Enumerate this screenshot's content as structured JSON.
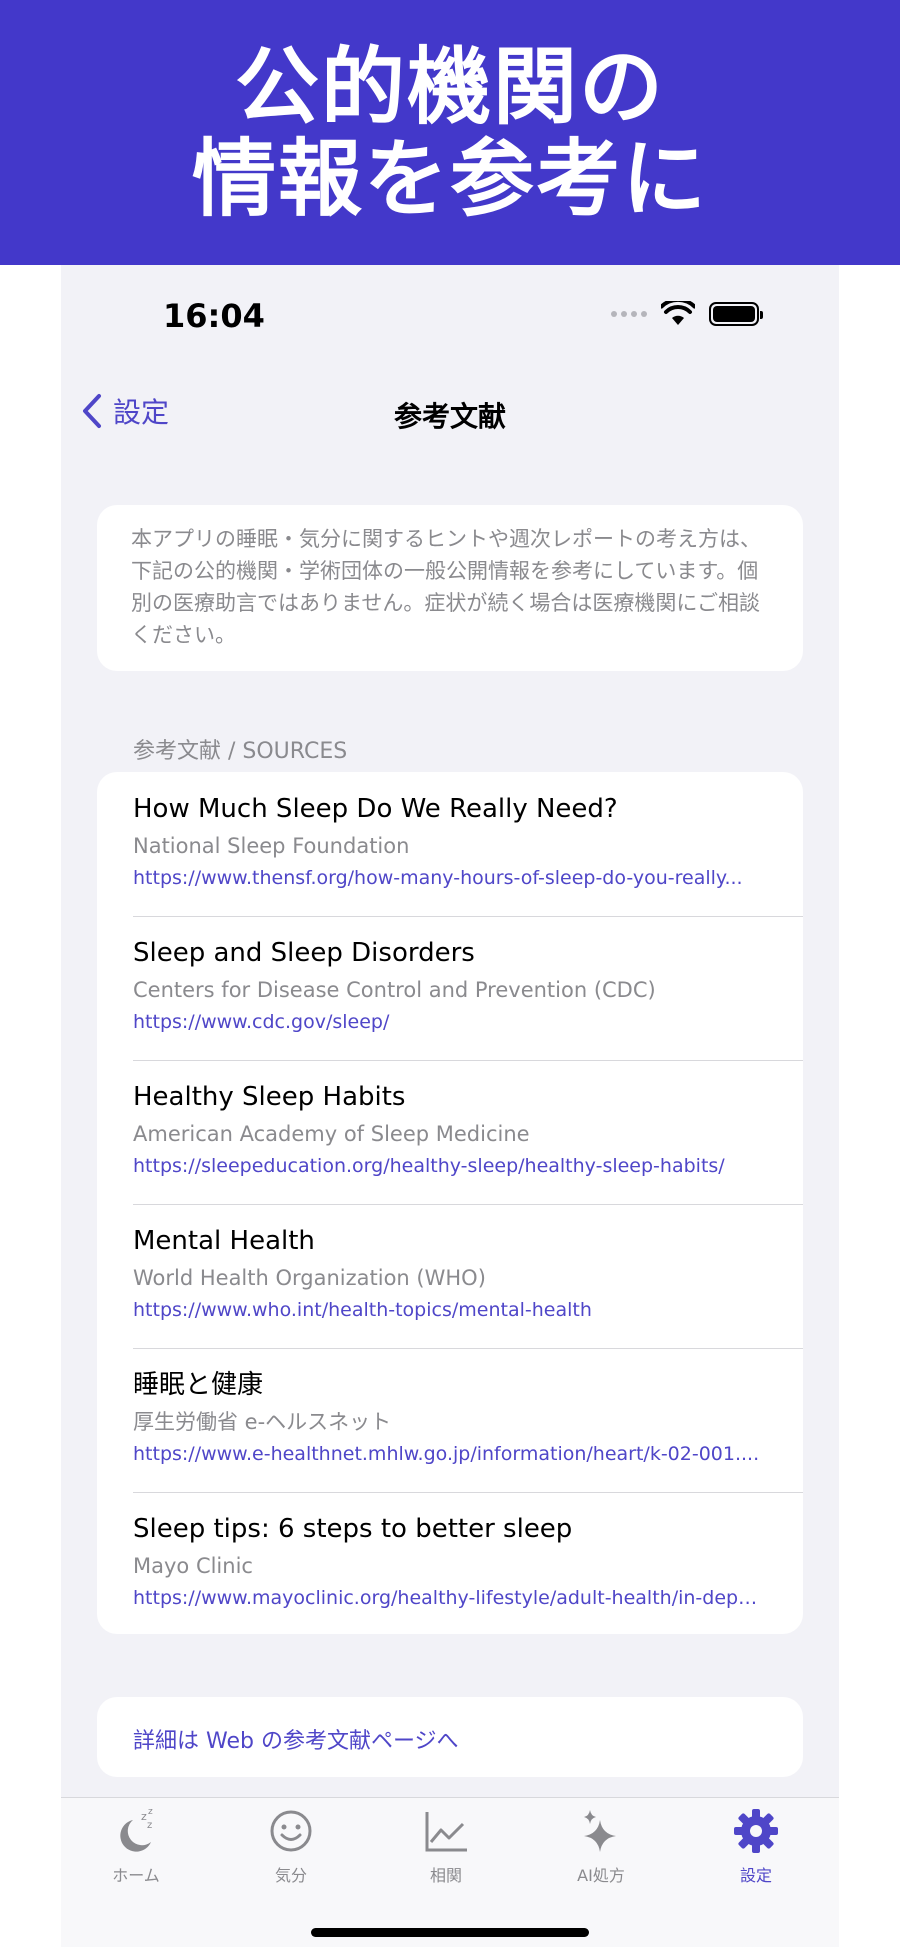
{
  "banner": {
    "line1": "公的機関の",
    "line2": "情報を参考に"
  },
  "status": {
    "time": "16:04"
  },
  "nav": {
    "back_label": "設定",
    "title": "参考文献"
  },
  "intro": {
    "text": "本アプリの睡眠・気分に関するヒントや週次レポートの考え方は、下記の公的機関・学術団体の一般公開情報を参考にしています。個別の医療助言ではありません。症状が続く場合は医療機関にご相談ください。"
  },
  "sources_header": "参考文献 / SOURCES",
  "sources": [
    {
      "title": "How Much Sleep Do We Really Need?",
      "org": "National Sleep Foundation",
      "url": "https://www.thensf.org/how-many-hours-of-sleep-do-you-really..."
    },
    {
      "title": "Sleep and Sleep Disorders",
      "org": "Centers for Disease Control and Prevention (CDC)",
      "url": "https://www.cdc.gov/sleep/"
    },
    {
      "title": "Healthy Sleep Habits",
      "org": "American Academy of Sleep Medicine",
      "url": "https://sleepeducation.org/healthy-sleep/healthy-sleep-habits/"
    },
    {
      "title": "Mental Health",
      "org": "World Health Organization (WHO)",
      "url": "https://www.who.int/health-topics/mental-health"
    },
    {
      "title": "睡眠と健康",
      "org": "厚生労働省 e-ヘルスネット",
      "url": "https://www.e-healthnet.mhlw.go.jp/information/heart/k-02-001...."
    },
    {
      "title": "Sleep tips: 6 steps to better sleep",
      "org": "Mayo Clinic",
      "url": "https://www.mayoclinic.org/healthy-lifestyle/adult-health/in-dept..."
    }
  ],
  "web_link": "詳細は Web の参考文献ページへ",
  "tabs": [
    {
      "label": "ホーム",
      "icon": "moon-zzz-icon"
    },
    {
      "label": "気分",
      "icon": "smiley-icon"
    },
    {
      "label": "相関",
      "icon": "chart-line-icon"
    },
    {
      "label": "AI処方",
      "icon": "sparkles-icon"
    },
    {
      "label": "設定",
      "icon": "gear-icon",
      "active": true
    }
  ],
  "colors": {
    "accent": "#4f46c8",
    "banner": "#4338ca",
    "background": "#f2f2f7"
  }
}
